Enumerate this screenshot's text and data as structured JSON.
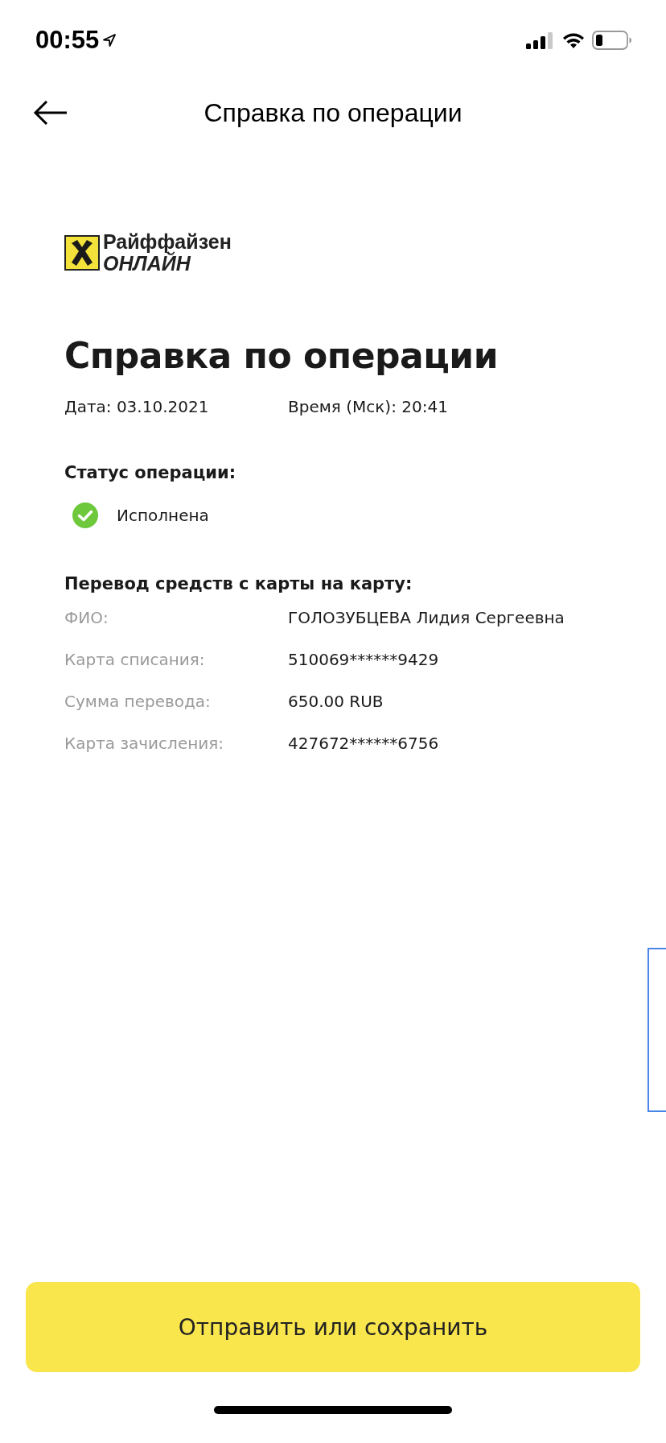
{
  "status_bar": {
    "time": "00:55"
  },
  "nav": {
    "title": "Справка по операции"
  },
  "logo": {
    "line_1": "Райффайзен",
    "line_2": "ОНЛАЙН"
  },
  "document": {
    "title": "Справка по операции",
    "date": "Дата: 03.10.2021",
    "time": "Время (Мск): 20:41",
    "status_heading": "Статус операции:",
    "status": {
      "kind": "success",
      "label": "Исполнена"
    },
    "section_heading": "Перевод средств с карты на карту:",
    "rows": [
      {
        "label": "ФИО:",
        "value": "ГОЛОЗУБЦЕВА Лидия Сергеевна"
      },
      {
        "label": "Карта списания:",
        "value": "510069******9429"
      },
      {
        "label": "Сумма перевода:",
        "value": "650.00 RUB"
      },
      {
        "label": "Карта зачисления:",
        "value": "427672******6756"
      }
    ]
  },
  "action_button": "Отправить или сохранить"
}
